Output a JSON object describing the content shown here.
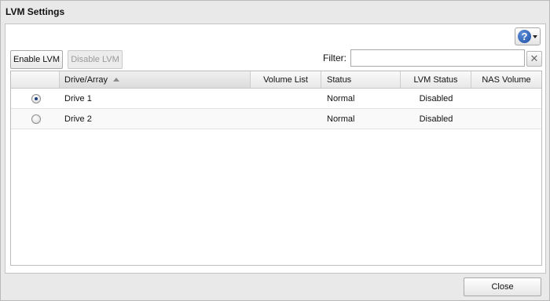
{
  "dialog": {
    "title": "LVM Settings"
  },
  "toolbar": {
    "enable_label": "Enable LVM",
    "disable_label": "Disable LVM",
    "filter_label": "Filter:",
    "filter_value": "",
    "clear_symbol": "✕",
    "help_symbol": "?"
  },
  "table": {
    "columns": [
      "",
      "Drive/Array",
      "Volume List",
      "Status",
      "LVM Status",
      "NAS Volume"
    ],
    "sorted_column": "Drive/Array",
    "sort_direction": "ascending",
    "rows": [
      {
        "selected": true,
        "drive": "Drive 1",
        "volume_list": "",
        "status": "Normal",
        "lvm_status": "Disabled",
        "nas_volume": ""
      },
      {
        "selected": false,
        "drive": "Drive 2",
        "volume_list": "",
        "status": "Normal",
        "lvm_status": "Disabled",
        "nas_volume": ""
      }
    ]
  },
  "footer": {
    "close_label": "Close"
  },
  "colors": {
    "help_accent": "#1d4fa6",
    "radio_dot": "#1b3f7a"
  }
}
